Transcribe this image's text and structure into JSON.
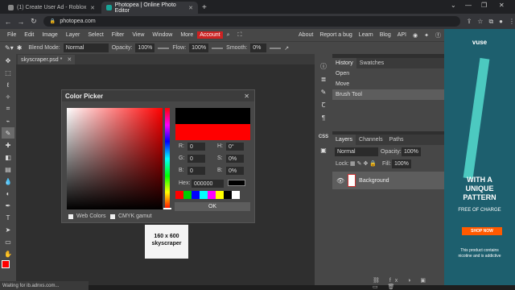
{
  "browser": {
    "tabs": [
      {
        "label": "(1) Create User Ad - Roblox",
        "fav_color": "#888888"
      },
      {
        "label": "Photopea | Online Photo Editor",
        "fav_color": "#18a497"
      }
    ],
    "new_tab": "+",
    "url": "photopea.com",
    "window_controls": [
      "⌄",
      "—",
      "❐",
      "✕"
    ]
  },
  "menubar": {
    "items": [
      "File",
      "Edit",
      "Image",
      "Layer",
      "Select",
      "Filter",
      "View",
      "Window",
      "More"
    ],
    "account": "Account",
    "right": [
      "About",
      "Report a bug",
      "Learn",
      "Blog",
      "API"
    ]
  },
  "options": {
    "blend_label": "Blend Mode:",
    "blend_value": "Normal",
    "opacity_label": "Opacity:",
    "opacity_value": "100%",
    "flow_label": "Flow:",
    "flow_value": "100%",
    "smooth_label": "Smooth:",
    "smooth_value": "0%"
  },
  "document": {
    "tab_label": "skyscraper.psd *",
    "ad_placeholder_size": "160 x 600",
    "ad_placeholder_name": "skyscraper"
  },
  "color_picker": {
    "title": "Color Picker",
    "r_label": "R:",
    "r_value": "0",
    "g_label": "G:",
    "g_value": "0",
    "b_label": "B:",
    "b_value": "0",
    "h_label": "H:",
    "h_value": "0°",
    "s_label": "S:",
    "s_value": "0%",
    "b2_label": "B:",
    "b2_value": "0%",
    "hex_label": "Hex:",
    "hex_value": "000000",
    "swatches": [
      "#ff0000",
      "#00cc00",
      "#0000ff",
      "#00ffff",
      "#ff00ff",
      "#ffff00",
      "#000000",
      "#ffffff"
    ],
    "ok_label": "OK",
    "web_colors_label": "Web Colors",
    "cmyk_label": "CMYK gamut",
    "current_color": "#ff0000"
  },
  "panels": {
    "history_tab": "History",
    "swatches_tab": "Swatches",
    "history_items": [
      "Open",
      "Move",
      "Brush Tool"
    ],
    "layers_tab": "Layers",
    "channels_tab": "Channels",
    "paths_tab": "Paths",
    "blend_value": "Normal",
    "opacity_label": "Opacity:",
    "opacity_value": "100%",
    "lock_label": "Lock:",
    "fill_label": "Fill:",
    "fill_value": "100%",
    "layer_name": "Background"
  },
  "status": "Waiting for ib.adnxs.com...",
  "ad": {
    "brand": "vuse",
    "headline": "WITH A UNIQUE PATTERN",
    "sub": "FREE OF CHARGE",
    "cta": "SHOP NOW",
    "disclaimer": "This product contains nicotine and is addictive"
  },
  "colors": {
    "accent_red": "#cc2222",
    "panel": "#474747",
    "ad_bg": "#1d5f6e"
  }
}
